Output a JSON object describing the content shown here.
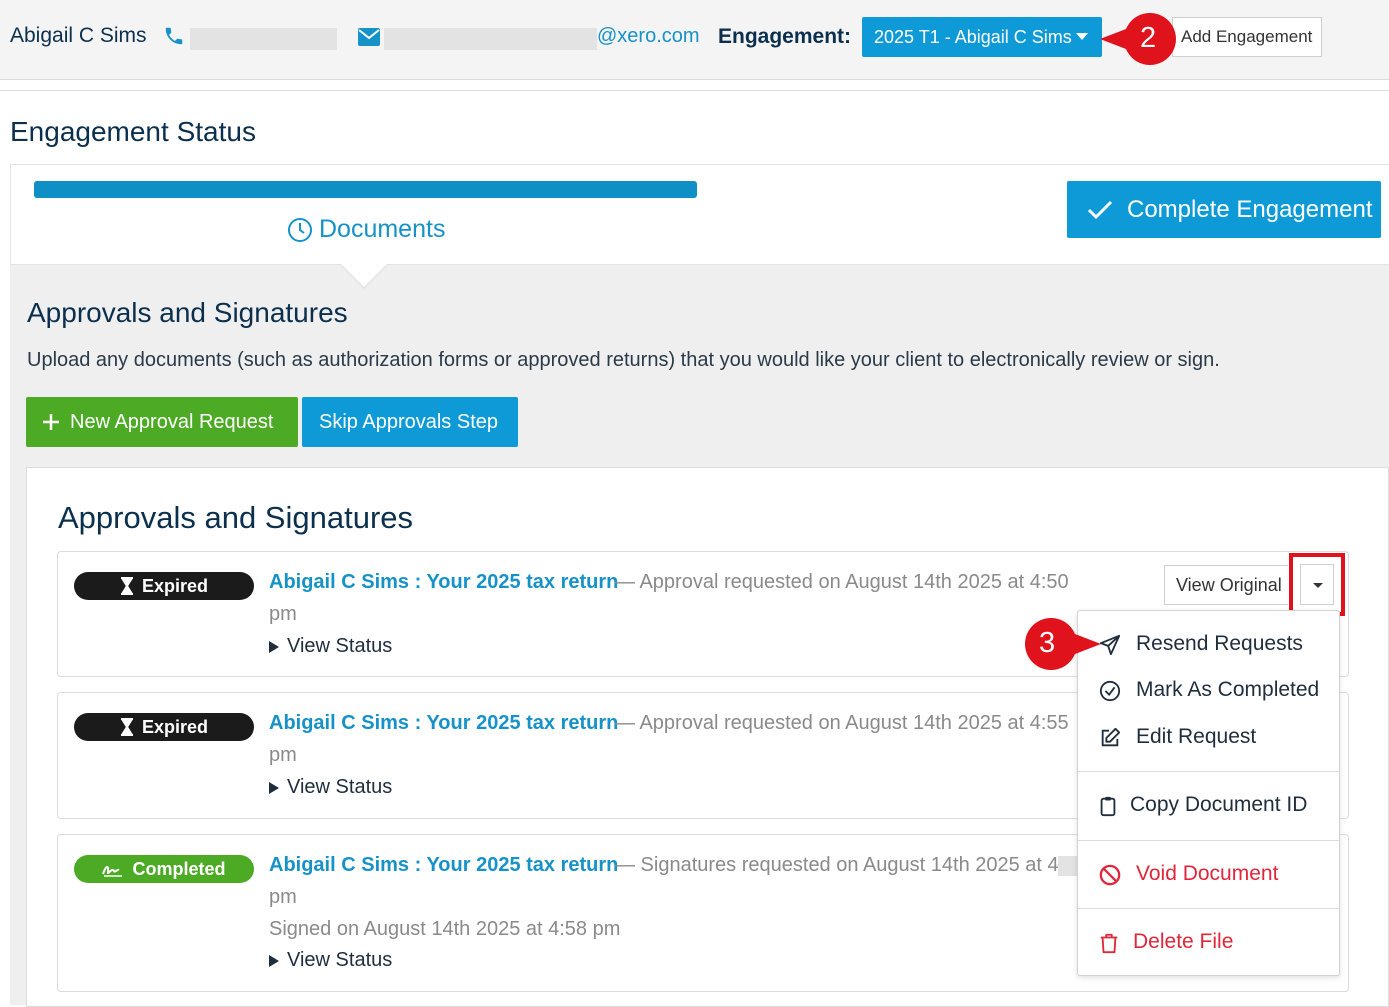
{
  "header": {
    "client_name": "Abigail C Sims",
    "phone_icon": "phone-icon",
    "email_icon": "mail-icon",
    "email_domain": "@xero.com",
    "engagement_label": "Engagement:",
    "engagement_selected": "2025 T1 - Abigail C Sims",
    "add_engagement_label": "Add Engagement",
    "step_marker": "2"
  },
  "status": {
    "title": "Engagement Status",
    "progress_percent": 100,
    "current_step": "Documents",
    "complete_button": "Complete Engagement"
  },
  "approvals": {
    "title": "Approvals and Signatures",
    "description": "Upload any documents (such as authorization forms or approved returns) that you would like your client to electronically review or sign.",
    "new_request_button": "New Approval Request",
    "skip_button": "Skip Approvals Step",
    "list_title": "Approvals and Signatures",
    "cards": [
      {
        "status": "Expired",
        "title": "Abigail C Sims : Your 2025 tax return",
        "request_text": "— Approval requested on August 14th 2025 at 4:50",
        "pm": "pm",
        "signed": "",
        "view_status": "View Status"
      },
      {
        "status": "Expired",
        "title": "Abigail C Sims : Your 2025 tax return",
        "request_text": "— Approval requested on August 14th 2025 at 4:55",
        "pm": "pm",
        "signed": "",
        "view_status": "View Status"
      },
      {
        "status": "Completed",
        "title": "Abigail C Sims : Your 2025 tax return",
        "request_text": "— Signatures requested on August 14th 2025 at 4",
        "pm": "pm",
        "signed": "Signed on August 14th 2025 at 4:58 pm",
        "view_status": "View Status"
      }
    ],
    "view_original_button": "View Original"
  },
  "dropdown": {
    "step_marker": "3",
    "items": [
      {
        "label": "Resend Requests",
        "icon": "send-icon",
        "danger": false
      },
      {
        "label": "Mark As Completed",
        "icon": "check-circle-icon",
        "danger": false
      },
      {
        "label": "Edit Request",
        "icon": "edit-icon",
        "danger": false
      },
      {
        "label": "Copy Document ID",
        "icon": "clipboard-icon",
        "danger": false
      },
      {
        "label": "Void Document",
        "icon": "ban-icon",
        "danger": true
      },
      {
        "label": "Delete File",
        "icon": "trash-icon",
        "danger": true
      }
    ]
  },
  "colors": {
    "brand_blue": "#0e9ad6",
    "link_blue": "#1792c8",
    "success_green": "#4caa25",
    "danger_red": "#e0263a",
    "marker_red": "#e0121b",
    "heading_navy": "#0b2f4d"
  }
}
